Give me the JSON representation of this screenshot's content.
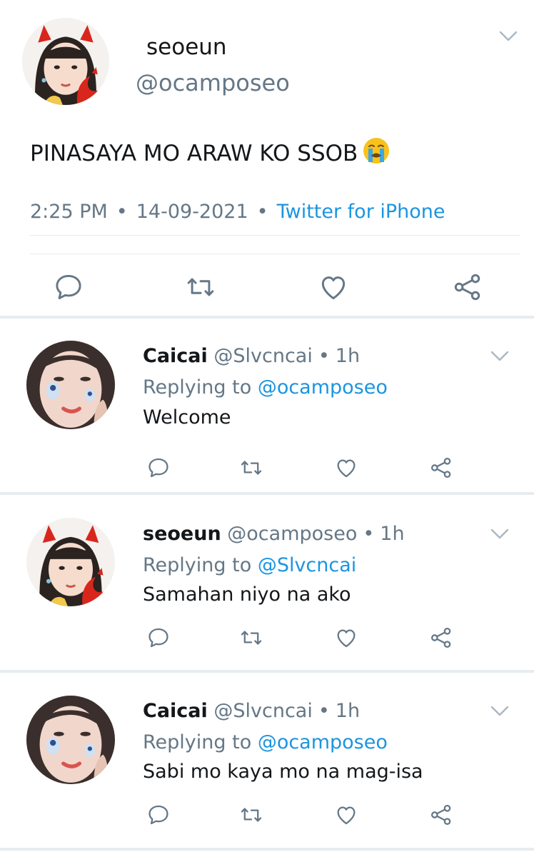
{
  "tweet": {
    "name": "seoeun",
    "handle": "@ocamposeo",
    "text": "PINASAYA MO ARAW KO SSOB",
    "emoji": "loudly-crying-face",
    "time": "2:25 PM",
    "date": "14-09-2021",
    "separator": "•",
    "source": "Twitter for iPhone"
  },
  "replies": [
    {
      "name": "Caicai",
      "handle": "@Slvcncai",
      "dot": "•",
      "time": "1h",
      "replying_prefix": "Replying to",
      "replying_to": "@ocamposeo",
      "text": "Welcome"
    },
    {
      "name": "seoeun",
      "handle": "@ocamposeo",
      "dot": "•",
      "time": "1h",
      "replying_prefix": "Replying to",
      "replying_to": "@Slvcncai",
      "text": "Samahan niyo na ako"
    },
    {
      "name": "Caicai",
      "handle": "@Slvcncai",
      "dot": "•",
      "time": "1h",
      "replying_prefix": "Replying to",
      "replying_to": "@ocamposeo",
      "text": "Sabi mo kaya mo na mag-isa"
    }
  ],
  "colors": {
    "link": "#1b95e0",
    "secondary_text": "#657786",
    "divider": "#e6ecf0",
    "icon": "#657786"
  },
  "icons": [
    "reply-icon",
    "retweet-icon",
    "like-icon",
    "share-icon",
    "chevron-down-icon"
  ]
}
